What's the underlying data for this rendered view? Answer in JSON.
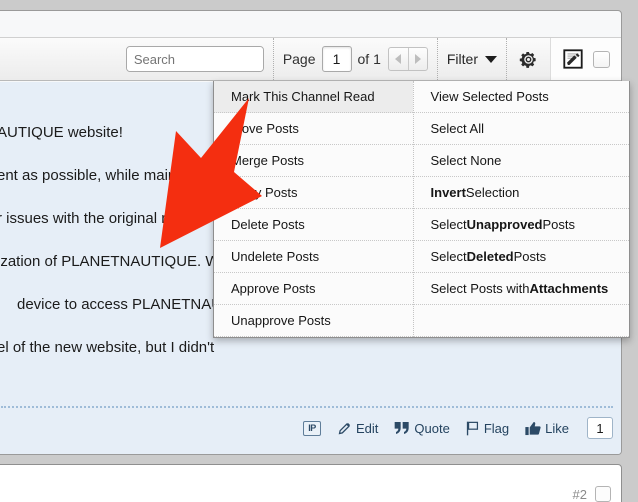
{
  "toolbar": {
    "search": {
      "value": "",
      "placeholder": "Search",
      "icon": "search-icon"
    },
    "paging": {
      "page_label": "Page",
      "page_value": "1",
      "of_label": "of 1",
      "prev_icon": "triangle-left-icon",
      "next_icon": "triangle-right-icon"
    },
    "filter": {
      "label": "Filter",
      "caret_icon": "caret-down-icon"
    },
    "gear": {
      "icon": "gear-icon"
    },
    "inline_mod": {
      "icon": "pencil-document-icon",
      "checkbox_icon": "checkbox-icon"
    }
  },
  "menu": {
    "left_column": [
      {
        "label": "Mark This Channel Read",
        "highlighted": true
      },
      {
        "label": "Move Posts",
        "highlighted": false
      },
      {
        "label": "Merge Posts",
        "highlighted": false
      },
      {
        "label": "Copy Posts",
        "highlighted": false
      },
      {
        "label": "Delete Posts",
        "highlighted": false
      },
      {
        "label": "Undelete Posts",
        "highlighted": false
      },
      {
        "label": "Approve Posts",
        "highlighted": false
      },
      {
        "label": "Unapprove Posts",
        "highlighted": false
      }
    ],
    "right_column": [
      {
        "prefix": "View Selected Posts",
        "bold": "",
        "suffix": ""
      },
      {
        "prefix": "Select All",
        "bold": "",
        "suffix": ""
      },
      {
        "prefix": "Select None",
        "bold": "",
        "suffix": ""
      },
      {
        "prefix": "",
        "bold": "Invert",
        "suffix": " Selection"
      },
      {
        "prefix": "Select ",
        "bold": "Unapproved",
        "suffix": " Posts"
      },
      {
        "prefix": "Select ",
        "bold": "Deleted",
        "suffix": " Posts"
      },
      {
        "prefix": "Select Posts with ",
        "bold": "Attachments",
        "suffix": ""
      }
    ]
  },
  "post": {
    "lines": [
      "AUTIQUE website!",
      "ent as possible, while maintaining",
      "r issues with the original release o",
      "ization of PLANETNAUTIQUE. W",
      "device to access PLANETNAUT",
      "el of the new website, but I didn't"
    ],
    "actions": {
      "ip_label": "IP",
      "edit_label": "Edit",
      "quote_label": "Quote",
      "flag_label": "Flag",
      "like_label": "Like",
      "like_count": "1",
      "edit_icon": "pencil-icon",
      "quote_icon": "quote-icon",
      "flag_icon": "flag-icon",
      "like_icon": "thumbs-up-icon"
    }
  },
  "next_post": {
    "number": "#2",
    "checkbox_icon": "checkbox-icon"
  },
  "annotation": {
    "arrow_color": "#f42e10",
    "arrow_name": "red-arrow-pointing-to-mark-channel-read"
  },
  "colors": {
    "post_background": "#e6eef7",
    "toolbar_background": "#ececec",
    "menu_background": "#fbfbfb",
    "menu_highlight": "#ececec",
    "accent_red": "#f42e10"
  }
}
